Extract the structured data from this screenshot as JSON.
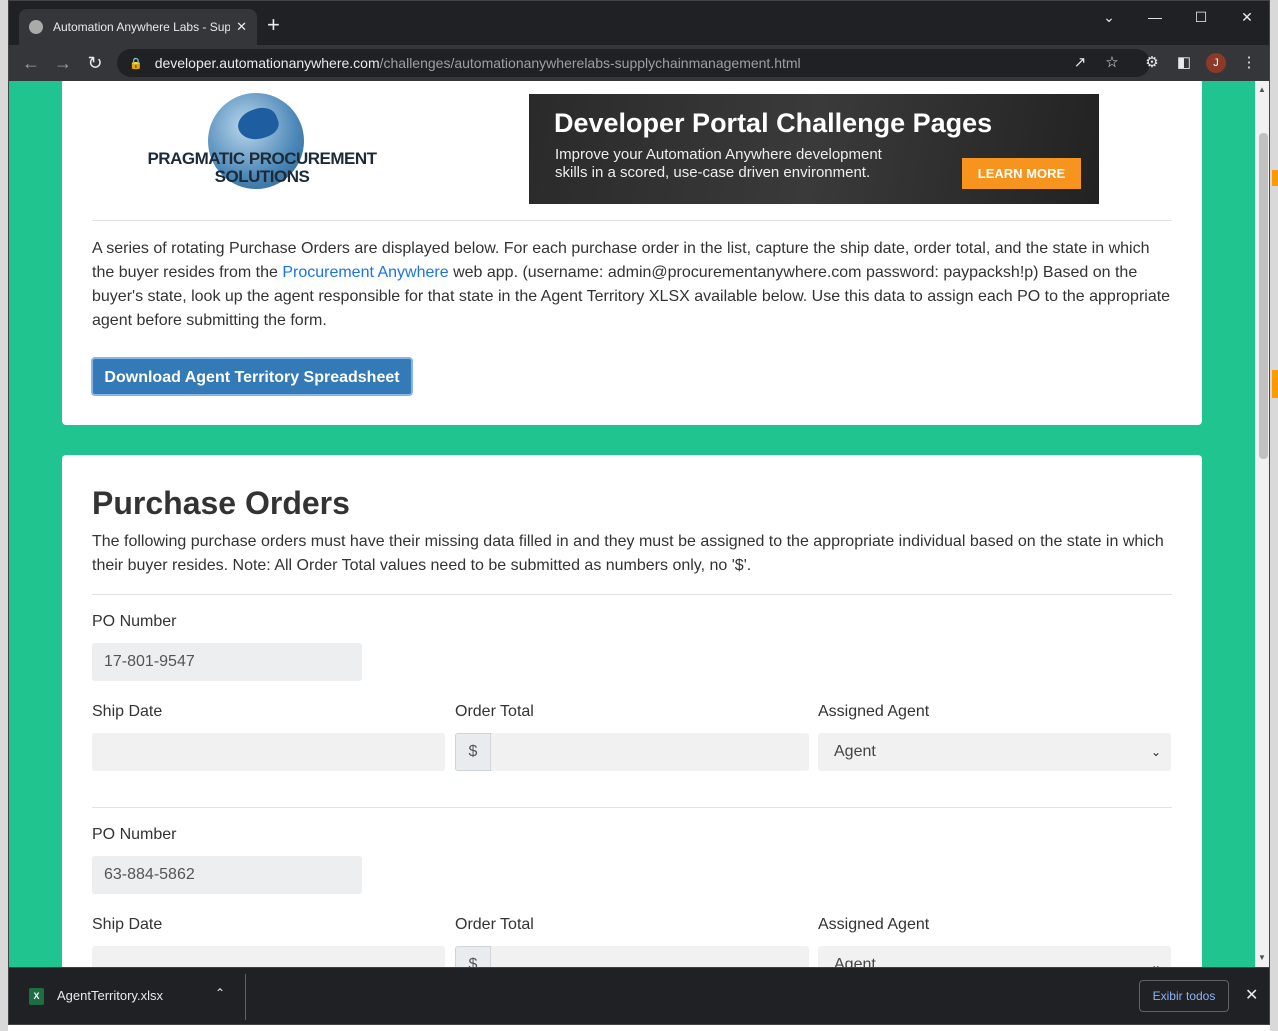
{
  "browser": {
    "tab_title": "Automation Anywhere Labs - Sup",
    "tab_close": "✕",
    "new_tab": "+",
    "url_domain": "developer.automationanywhere.com",
    "url_path": "/challenges/automationanywherelabs-supplychainmanagement.html",
    "profile_initial": "J",
    "controls": {
      "tabsearch": "⌄",
      "minimize": "—",
      "maximize": "☐",
      "close": "✕"
    }
  },
  "header": {
    "logo_line1": "PRAGMATIC PROCUREMENT",
    "logo_line2": "SOLUTIONS",
    "banner_title": "Developer Portal Challenge Pages",
    "banner_line1": "Improve your Automation Anywhere development",
    "banner_line2": "skills in a scored, use-case driven environment.",
    "banner_button": "LEARN MORE"
  },
  "intro": {
    "text_before_link": "A series of rotating Purchase Orders are displayed below. For each purchase order in the list, capture the ship date, order total, and the state in which the buyer resides from the ",
    "link_text": "Procurement Anywhere",
    "text_after_link": " web app. (username: admin@procurementanywhere.com password: paypacksh!p) Based on the buyer's state, look up the agent responsible for that state in the Agent Territory XLSX available below. Use this data to assign each PO to the appropriate agent before submitting the form.",
    "download_button": "Download Agent Territory Spreadsheet"
  },
  "purchase_orders": {
    "heading": "Purchase Orders",
    "description": "The following purchase orders must have their missing data filled in and they must be assigned to the appropriate individual based on the state in which their buyer resides. Note: All Order Total values need to be submitted as numbers only, no '$'.",
    "labels": {
      "po_number": "PO Number",
      "ship_date": "Ship Date",
      "order_total": "Order Total",
      "assigned_agent": "Assigned Agent",
      "currency_symbol": "$"
    },
    "items": [
      {
        "po_number": "17-801-9547",
        "ship_date": "",
        "order_total": "",
        "agent": "Agent"
      },
      {
        "po_number": "63-884-5862",
        "ship_date": "",
        "order_total": "",
        "agent": "Agent"
      }
    ]
  },
  "downloads": {
    "file_name": "AgentTerritory.xlsx",
    "show_all": "Exibir todos"
  }
}
